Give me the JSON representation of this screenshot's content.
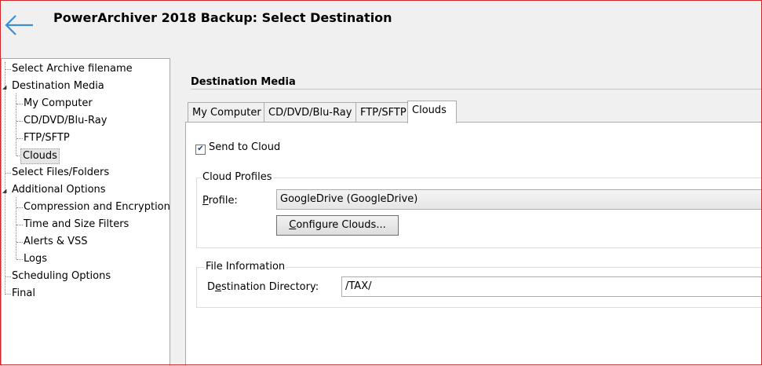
{
  "window": {
    "title": "PowerArchiver 2018 Backup: Select Destination",
    "back_icon": "arrow-left-icon"
  },
  "tree": {
    "items": [
      {
        "label": "Select Archive filename"
      },
      {
        "label": "Destination Media"
      },
      {
        "label": "My Computer"
      },
      {
        "label": "CD/DVD/Blu-Ray"
      },
      {
        "label": "FTP/SFTP"
      },
      {
        "label": "Clouds"
      },
      {
        "label": "Select Files/Folders"
      },
      {
        "label": "Additional Options"
      },
      {
        "label": "Compression and Encryption"
      },
      {
        "label": "Time and Size Filters"
      },
      {
        "label": "Alerts & VSS"
      },
      {
        "label": "Logs"
      },
      {
        "label": "Scheduling Options"
      },
      {
        "label": "Final"
      }
    ],
    "selected": "Clouds"
  },
  "main": {
    "section_title": "Destination Media",
    "tabs": [
      {
        "label": "My Computer"
      },
      {
        "label": "CD/DVD/Blu-Ray"
      },
      {
        "label": "FTP/SFTP"
      },
      {
        "label": "Clouds"
      }
    ],
    "active_tab": "Clouds",
    "send_to_cloud": {
      "label": "Send to Cloud",
      "checked": true
    },
    "cloud_profiles": {
      "group_label": "Cloud Profiles",
      "profile_label_accel": "P",
      "profile_label_rest": "rofile:",
      "profile_value": "GoogleDrive (GoogleDrive)",
      "configure_accel": "C",
      "configure_rest": "onfigure Clouds..."
    },
    "file_information": {
      "group_label": "File Information",
      "dest_label_pre": "D",
      "dest_label_accel": "e",
      "dest_label_rest": "stination Directory:",
      "dest_value": "/TAX/"
    }
  },
  "colors": {
    "window_border": "#d0262b",
    "back_arrow": "#3b8fd6",
    "panel_bg": "#f0f0f0",
    "content_bg": "#ffffff"
  }
}
